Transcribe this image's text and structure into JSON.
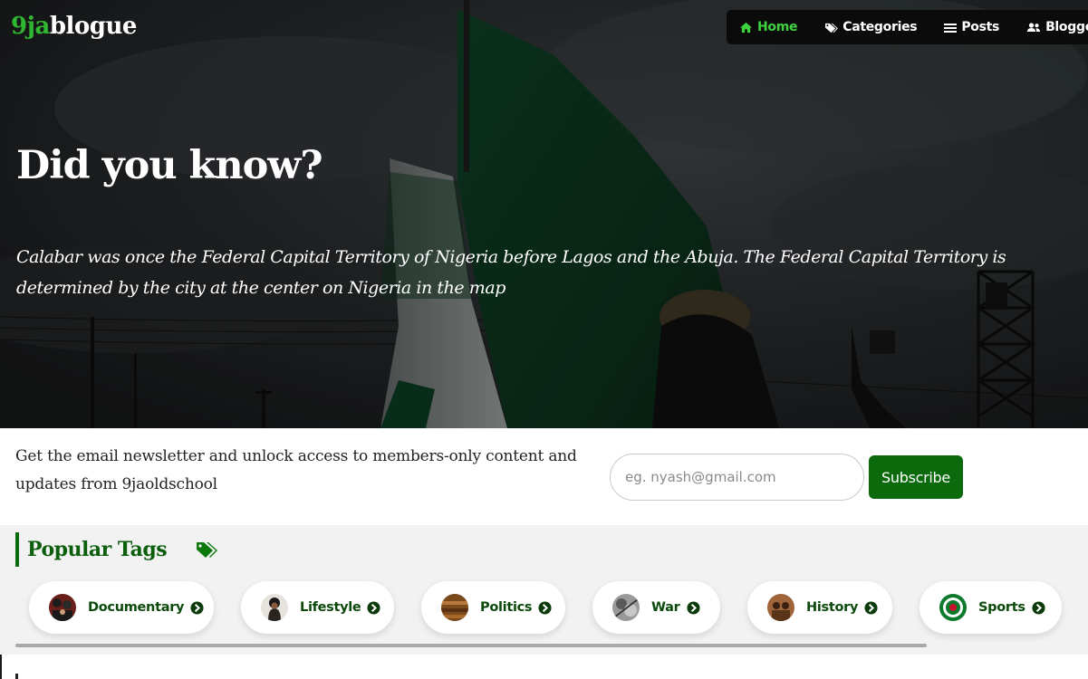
{
  "header": {
    "logo_part1": "9ja",
    "logo_part2": "blogue"
  },
  "nav": {
    "items": [
      {
        "label": "Home",
        "icon": "home-icon",
        "active": true
      },
      {
        "label": "Categories",
        "icon": "tags-icon",
        "active": false
      },
      {
        "label": "Posts",
        "icon": "list-icon",
        "active": false
      },
      {
        "label": "Bloggers",
        "icon": "users-icon",
        "active": false
      }
    ]
  },
  "hero": {
    "title": "Did you know?",
    "text": "Calabar was once the Federal Capital Territory of Nigeria before Lagos and the Abuja. The Federal Capital Territory is determined by the city at the center on Nigeria in the map"
  },
  "newsletter": {
    "text": "Get the email newsletter and unlock access to members-only content and updates from 9jaoldschool",
    "input_placeholder": "eg. nyash@gmail.com",
    "input_value": "",
    "button_label": "Subscribe"
  },
  "tags": {
    "title": "Popular Tags",
    "icon": "tags-icon",
    "items": [
      {
        "label": "Documentary",
        "icon": "arrow-circle-right-icon"
      },
      {
        "label": "Lifestyle",
        "icon": "arrow-circle-right-icon"
      },
      {
        "label": "Politics",
        "icon": "arrow-circle-right-icon"
      },
      {
        "label": "War",
        "icon": "arrow-circle-right-icon"
      },
      {
        "label": "History",
        "icon": "arrow-circle-right-icon"
      },
      {
        "label": "Sports",
        "icon": "arrow-circle-right-icon"
      }
    ]
  },
  "colors": {
    "brand_green": "#0b6a0b",
    "logo_green": "#2fb52f",
    "nav_active": "#3fd23f",
    "nav_background": "#0b0b0b"
  }
}
